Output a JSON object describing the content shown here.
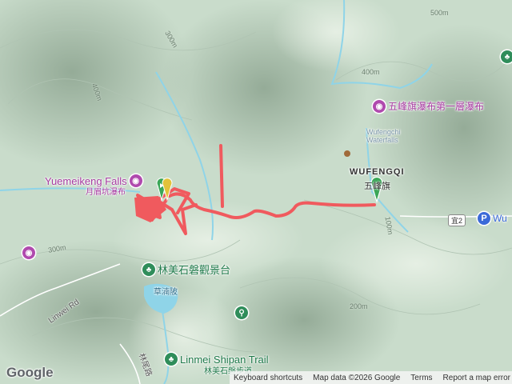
{
  "map": {
    "colors": {
      "track": "#f05a5e",
      "terrain": "#c9dccb",
      "river": "#8fd4e8",
      "poi_purple": "#b04aae",
      "poi_green": "#2f8d5a"
    },
    "pois": {
      "yuemeikeng_en": "Yuemeikeng Falls",
      "yuemeikeng_zh": "月眉坑瀑布",
      "wufengqi_fall_zh": "五峰旗瀑布第一層瀑布",
      "wufengqi_fall_en_faint": "Wufengchi\nWaterfalls",
      "linmei_observ_zh": "林美石磐觀景台",
      "pond_zh": "草湳陂",
      "linmei_trail_en": "Linmei Shipan Trail",
      "linmei_trail_zh": "林美石磐步道",
      "parking_label": "Wu"
    },
    "town": {
      "en": "WUFENGQI",
      "zh": "五峰旗"
    },
    "roads": {
      "linwei_en": "Linwei Rd",
      "linwei_zh": "林尾路",
      "route_shield": "宜2"
    },
    "contours": [
      "500m",
      "400m",
      "300m",
      "400m",
      "300m",
      "100m",
      "200m",
      "300m"
    ],
    "icons": [
      "camera-icon",
      "tree-icon",
      "hiking-icon",
      "parking-icon",
      "start-flag-icon",
      "end-flag-icon"
    ]
  },
  "footer": {
    "logo": "Google",
    "keyboard": "Keyboard shortcuts",
    "data": "Map data ©2026 Google",
    "terms": "Terms",
    "report": "Report a map error"
  }
}
